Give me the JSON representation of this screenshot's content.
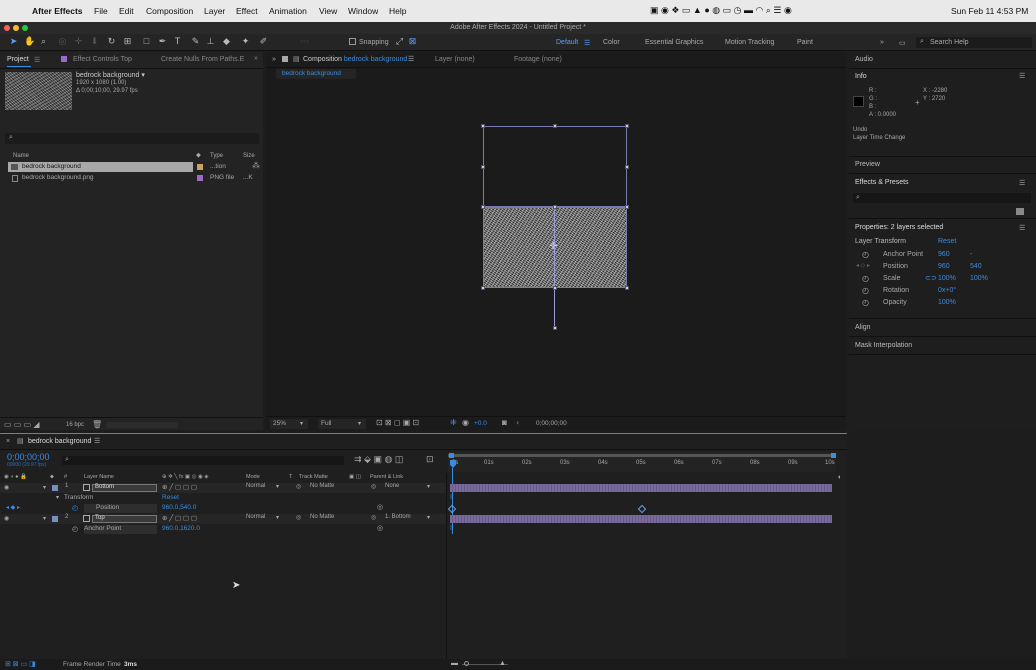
{
  "menubar": {
    "app_name": "After Effects",
    "items": [
      "File",
      "Edit",
      "Composition",
      "Layer",
      "Effect",
      "Animation",
      "View",
      "Window",
      "Help"
    ],
    "clock": "Sun Feb 11  4:53 PM"
  },
  "window_title": "Adobe After Effects 2024 - Untitled Project *",
  "toolbar": {
    "snapping_label": "Snapping",
    "workspaces": [
      "Default",
      "Color",
      "Essential Graphics",
      "Motion Tracking",
      "Paint"
    ],
    "search_placeholder": "Search Help"
  },
  "project_panel": {
    "tabs": [
      "Project",
      "Effect Controls Top",
      "Create Nulls From Paths.E"
    ],
    "thumb_name": "bedrock background ▾",
    "thumb_info1": "1920 x 1080 (1.00)",
    "thumb_info2": "Δ 0;00;10;00, 29.97 fps",
    "columns": [
      "Name",
      "Type",
      "Size"
    ],
    "items": [
      {
        "name": "bedrock background",
        "type": "...tion",
        "size": ""
      },
      {
        "name": "bedrock background.png",
        "type": "PNG file",
        "size": "...K"
      }
    ],
    "bpc": "16 bpc"
  },
  "comp_viewer": {
    "tab_label": "Composition",
    "tab_comp": "bedrock background",
    "layer_tab": "Layer (none)",
    "footage_tab": "Footage (none)",
    "breadcrumb": "bedrock background",
    "zoom": "25%",
    "resolution": "Full",
    "exposure": "+0.0",
    "timecode": "0;00;00;00"
  },
  "right_panel": {
    "audio": "Audio",
    "info": {
      "title": "Info",
      "r": "R :",
      "g": "G :",
      "b": "B :",
      "a": "A : 0.0000",
      "x": "X : -2280",
      "y": "Y : 2720",
      "undo": "Undo",
      "undo_action": "Layer Time Change"
    },
    "preview": "Preview",
    "effects": "Effects & Presets",
    "properties": {
      "title": "Properties: 2 layers selected",
      "layer_transform": "Layer Transform",
      "reset": "Reset",
      "rows": [
        {
          "label": "Anchor Point",
          "v1": "960",
          "v2": "-"
        },
        {
          "label": "Position",
          "v1": "960",
          "v2": "540"
        },
        {
          "label": "Scale",
          "v1": "100%",
          "v2": "100%"
        },
        {
          "label": "Rotation",
          "v1": "0x+0°",
          "v2": ""
        },
        {
          "label": "Opacity",
          "v1": "100%",
          "v2": ""
        }
      ]
    },
    "align": "Align",
    "mask_interp": "Mask Interpolation"
  },
  "timeline": {
    "tab": "bedrock background",
    "timecode": "0;00;00;00",
    "timecode_sub": "00000 (29.97 fps)",
    "ruler": [
      "0s",
      "01s",
      "02s",
      "03s",
      "04s",
      "05s",
      "06s",
      "07s",
      "08s",
      "09s",
      "10s"
    ],
    "col_headers": {
      "num": "#",
      "layer_name": "Layer Name",
      "mode": "Mode",
      "t": "T",
      "track_matte": "Track Matte",
      "parent": "Parent & Link"
    },
    "layers": [
      {
        "num": "1",
        "name": "Bottom",
        "mode": "Normal",
        "matte": "No Matte",
        "parent": "None"
      },
      {
        "num": "2",
        "name": "Top",
        "mode": "Normal",
        "matte": "No Matte",
        "parent": "1. Bottom"
      }
    ],
    "transform_label": "Transform",
    "transform_reset": "Reset",
    "position_label": "Position",
    "position_value": "960.0,540.0",
    "anchor_label": "Anchor Point",
    "anchor_value": "960.0,1620.0",
    "frame_render_label": "Frame Render Time",
    "frame_render_value": "3ms"
  }
}
